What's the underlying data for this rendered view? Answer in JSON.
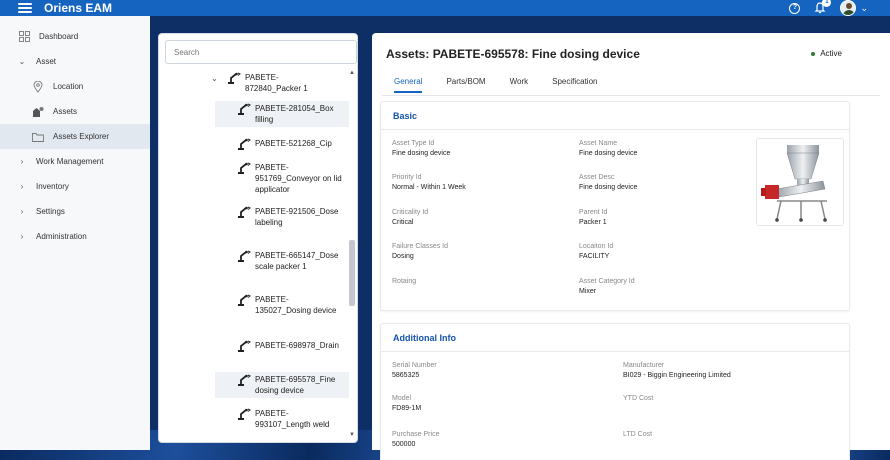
{
  "app": {
    "title": "Oriens EAM",
    "notification_count": "1"
  },
  "sidebar": {
    "items": [
      {
        "label": "Dashboard"
      },
      {
        "label": "Asset"
      },
      {
        "label": "Location"
      },
      {
        "label": "Assets"
      },
      {
        "label": "Assets Explorer"
      },
      {
        "label": "Work Management"
      },
      {
        "label": "Inventory"
      },
      {
        "label": "Settings"
      },
      {
        "label": "Administration"
      }
    ]
  },
  "tree": {
    "search_placeholder": "Search",
    "nodes": [
      {
        "label": "PABETE-872840_Packer 1"
      },
      {
        "label": "PABETE-281054_Box filling"
      },
      {
        "label": "PABETE-521268_Cip"
      },
      {
        "label": "PABETE-951769_Conveyor on lid applicator"
      },
      {
        "label": "PABETE-921506_Dose labeling"
      },
      {
        "label": "PABETE-665147_Dose scale packer 1"
      },
      {
        "label": "PABETE-135027_Dosing device"
      },
      {
        "label": "PABETE-698978_Drain"
      },
      {
        "label": "PABETE-695578_Fine dosing device"
      },
      {
        "label": "PABETE-993107_Length weld"
      }
    ]
  },
  "detail": {
    "title": "Assets: PABETE-695578: Fine dosing device",
    "status": "Active",
    "tabs": [
      {
        "label": "General"
      },
      {
        "label": "Parts/BOM"
      },
      {
        "label": "Work"
      },
      {
        "label": "Specification"
      }
    ],
    "basic": {
      "title": "Basic",
      "fields": {
        "asset_type_label": "Asset Type Id",
        "asset_type_value": "Fine dosing device",
        "asset_name_label": "Asset Name",
        "asset_name_value": "Fine dosing device",
        "priority_label": "Priority Id",
        "priority_value": "Normal - Within 1 Week",
        "asset_desc_label": "Asset Desc",
        "asset_desc_value": "Fine dosing device",
        "criticality_label": "Criticality Id",
        "criticality_value": "Critical",
        "parent_label": "Parent Id",
        "parent_value": "Packer 1",
        "failure_label": "Failure Classes Id",
        "failure_value": "Dosing",
        "location_label": "Locaiton Id",
        "location_value": "FACILITY",
        "rotaing_label": "Rotaing",
        "category_label": "Asset Category Id",
        "category_value": "Mixer"
      }
    },
    "additional": {
      "title": "Additional Info",
      "fields": {
        "serial_label": "Serial Number",
        "serial_value": "5865325",
        "manufacturer_label": "Manufacturer",
        "manufacturer_value": "BI029 - Biggin Engineering Limited",
        "model_label": "Model",
        "model_value": "FD89-1M",
        "ytd_label": "YTD Cost",
        "price_label": "Purchase Price",
        "price_value": "500000",
        "ltd_label": "LTD Cost"
      }
    }
  },
  "colors": {
    "primary": "#1565c0",
    "section_title": "#1553a8",
    "active_dot": "#2e7d32"
  }
}
